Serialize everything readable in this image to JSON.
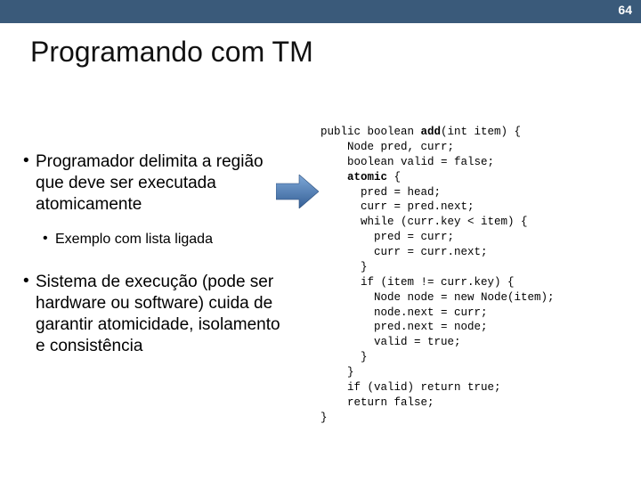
{
  "page_number": "64",
  "title": "Programando com TM",
  "bullets": {
    "b1": "Programador delimita a região que deve ser executada atomicamente",
    "b1_sub": "Exemplo com lista ligada",
    "b2": "Sistema de execução (pode ser hardware ou software) cuida de garantir atomicidade, isolamento e consistência"
  },
  "code": {
    "l01a": "public boolean ",
    "l01b": "add",
    "l01c": "(int item) {",
    "l02": "    Node pred, curr;",
    "l03": "    boolean valid = false;",
    "l04": "",
    "l05a": "    ",
    "l05b": "atomic",
    "l05c": " {",
    "l06": "      pred = head;",
    "l07": "      curr = pred.next;",
    "l08": "      while (curr.key < item) {",
    "l09": "        pred = curr;",
    "l10": "        curr = curr.next;",
    "l11": "      }",
    "l12": "      if (item != curr.key) {",
    "l13": "        Node node = new Node(item);",
    "l14": "        node.next = curr;",
    "l15": "        pred.next = node;",
    "l16": "        valid = true;",
    "l17": "      }",
    "l18": "    }",
    "l19": "    if (valid) return true;",
    "l20": "    return false;",
    "l21": "}"
  }
}
